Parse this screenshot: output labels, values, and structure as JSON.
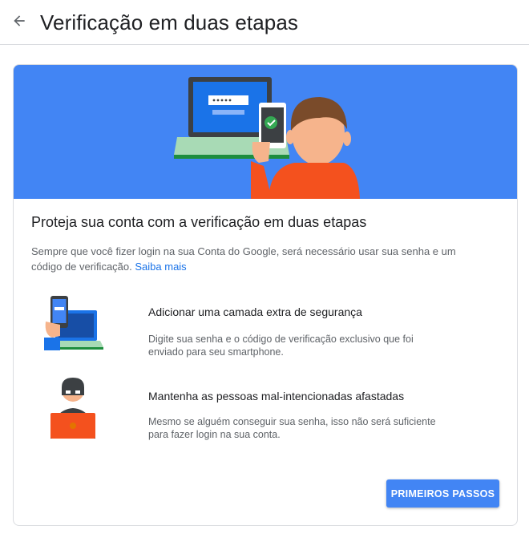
{
  "header": {
    "back_icon": "arrow-left-icon",
    "title": "Verificação em duas etapas"
  },
  "card": {
    "title": "Proteja sua conta com a verificação em duas etapas",
    "description": "Sempre que você fizer login na sua Conta do Google, será necessário usar sua senha e um código de verificação.",
    "learn_more": "Saiba mais",
    "features": [
      {
        "icon": "phone-laptop-icon",
        "title": "Adicionar uma camada extra de segurança",
        "description": "Digite sua senha e o código de verificação exclusivo que foi enviado para seu smartphone."
      },
      {
        "icon": "masked-intruder-icon",
        "title": "Mantenha as pessoas mal-intencionadas afastadas",
        "description": "Mesmo se alguém conseguir sua senha, isso não será suficiente para fazer login na sua conta."
      }
    ],
    "primary_button": "PRIMEIROS PASSOS"
  },
  "colors": {
    "accent": "#4285f4",
    "link": "#1a73e8",
    "banner": "#4285f4",
    "text_primary": "#202124",
    "text_secondary": "#5f6368"
  }
}
